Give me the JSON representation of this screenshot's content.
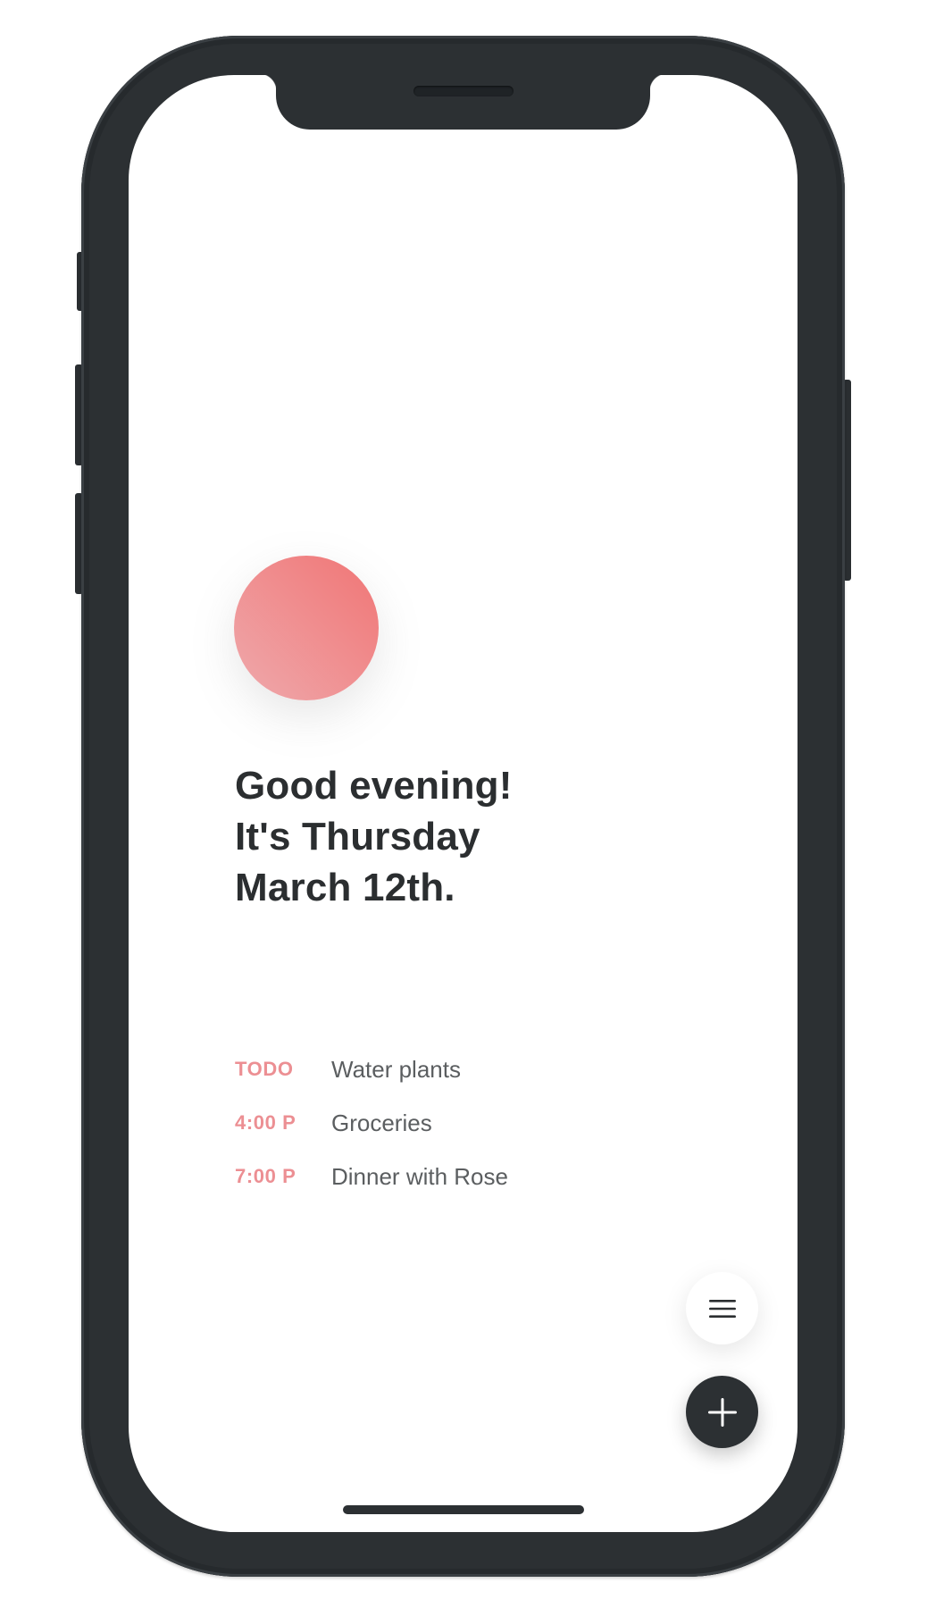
{
  "greeting": {
    "line1": "Good evening!",
    "line2": "It's Thursday",
    "line3": "March 12th."
  },
  "agenda": [
    {
      "label": "TODO",
      "text": "Water plants"
    },
    {
      "label": "4:00 P",
      "text": "Groceries"
    },
    {
      "label": "7:00 P",
      "text": "Dinner with Rose"
    }
  ],
  "buttons": {
    "menu_icon": "hamburger-menu-icon",
    "add_icon": "plus-icon"
  },
  "colors": {
    "accent": "#ec8f93",
    "sun_start": "#f07575",
    "sun_end": "#efa9ac",
    "text_dark": "#2b2e30",
    "text_muted": "#5b5e60",
    "phone_body": "#2c3033"
  }
}
